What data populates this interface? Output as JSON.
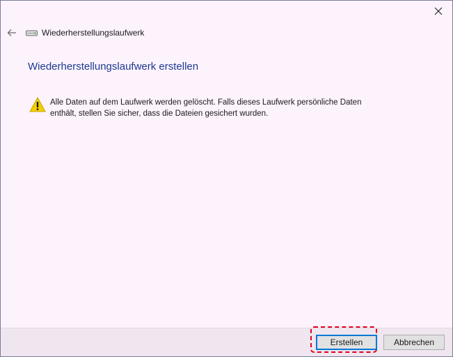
{
  "window": {
    "title": "Wiederherstellungslaufwerk"
  },
  "page": {
    "heading": "Wiederherstellungslaufwerk erstellen",
    "warning_text": "Alle Daten auf dem Laufwerk werden gelöscht. Falls dieses Laufwerk persönliche Daten enthält, stellen Sie sicher, dass die Dateien gesichert wurden."
  },
  "footer": {
    "create_label": "Erstellen",
    "cancel_label": "Abbrechen"
  },
  "icons": {
    "close": "close-icon",
    "back": "back-arrow-icon",
    "drive": "drive-icon",
    "warning": "warning-icon"
  },
  "colors": {
    "window_background": "#fdf3fd",
    "footer_background": "#efe6ef",
    "heading_color": "#1c3a8e",
    "highlight_color": "#e0001b",
    "primary_border": "#0078d7",
    "warning_yellow": "#f5d000"
  }
}
